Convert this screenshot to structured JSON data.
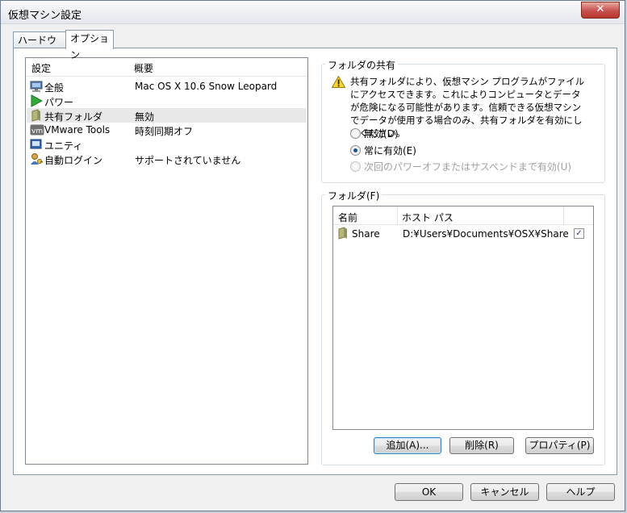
{
  "window": {
    "title": "仮想マシン設定",
    "close_label": "✕"
  },
  "tabs": [
    {
      "label": "ハードウェア"
    },
    {
      "label": "オプション"
    }
  ],
  "settings_list": {
    "header": {
      "setting": "設定",
      "summary": "概要"
    },
    "items": [
      {
        "label": "全般",
        "summary": "Mac OS X 10.6 Snow Leopard",
        "icon": "monitor-icon"
      },
      {
        "label": "パワー",
        "summary": "",
        "icon": "power-play-icon"
      },
      {
        "label": "共有フォルダ",
        "summary": "無効",
        "icon": "shared-folder-icon",
        "selected": true
      },
      {
        "label": "VMware Tools",
        "summary": "時刻同期オフ",
        "icon": "vmware-tools-icon"
      },
      {
        "label": "ユニティ",
        "summary": "",
        "icon": "unity-icon"
      },
      {
        "label": "自動ログイン",
        "summary": "サポートされていません",
        "icon": "autologin-icon"
      }
    ]
  },
  "sharing": {
    "legend": "フォルダの共有",
    "warning_icon": "warning-icon",
    "warning_text": "共有フォルダにより、仮想マシン プログラムがファイルにアクセスできます。これによりコンピュータとデータが危険になる可能性があります。信頼できる仮想マシンでデータが使用する場合のみ、共有フォルダを有効にしてください。",
    "options": [
      {
        "label": "無効(D)",
        "checked": false,
        "disabled": false
      },
      {
        "label": "常に有効(E)",
        "checked": true,
        "disabled": false
      },
      {
        "label": "次回のパワーオフまたはサスペンドまで有効(U)",
        "checked": false,
        "disabled": true
      }
    ]
  },
  "folders": {
    "legend": "フォルダ(F)",
    "columns": {
      "name": "名前",
      "host_path": "ホスト パス"
    },
    "rows": [
      {
        "name": "Share",
        "host_path": "D:¥Users¥Documents¥OSX¥Share",
        "enabled": true,
        "icon": "folder-icon"
      }
    ],
    "buttons": {
      "add": "追加(A)...",
      "remove": "削除(R)",
      "properties": "プロパティ(P)"
    }
  },
  "footer": {
    "ok": "OK",
    "cancel": "キャンセル",
    "help": "ヘルプ"
  }
}
